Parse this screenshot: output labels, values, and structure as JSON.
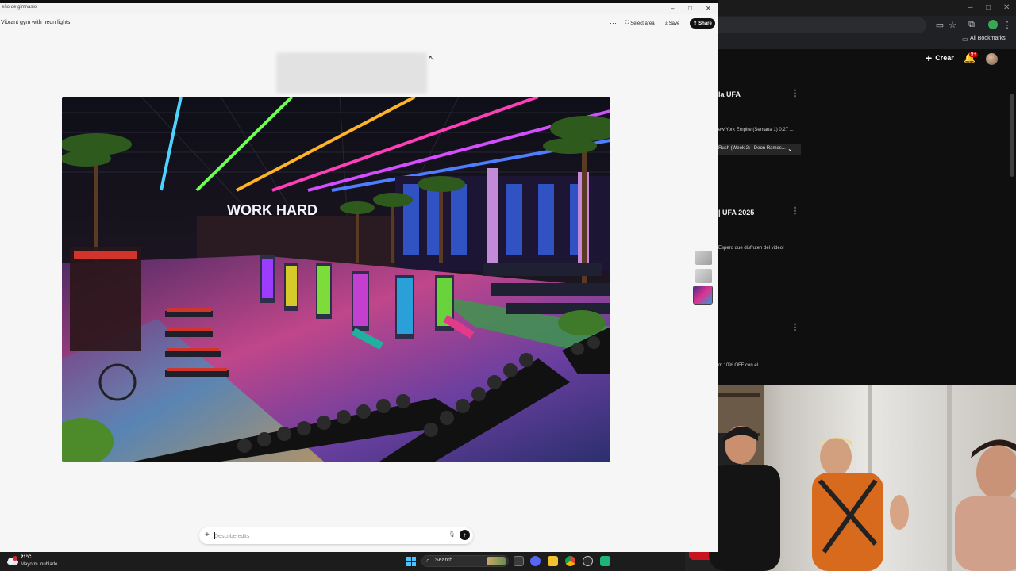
{
  "designer": {
    "window_title": "eño de gimnasio",
    "prompt_title": "Vibrant gym with neon lights",
    "header": {
      "more_icon": "more-horizontal-icon",
      "select_area_label": "Select area",
      "save_label": "Save",
      "share_label": "Share"
    },
    "image": {
      "sign_text": "WORK HARD"
    },
    "prompt_bar": {
      "placeholder": "Describe edits"
    }
  },
  "browser": {
    "all_bookmarks_label": "All Bookmarks"
  },
  "youtube": {
    "create_label": "Crear",
    "notification_badge": "9+",
    "items": [
      {
        "title": "la UFA",
        "subtitle": "ew York Empire (Semana 1) 0:27 ...",
        "chip": "Rush (Week 2) | Deon Ramos..."
      },
      {
        "title": "| UFA 2025",
        "subtitle": "Espero que disfruten del video!"
      },
      {
        "title": "",
        "subtitle": "m 10% OFF con el ..."
      }
    ]
  },
  "taskbar": {
    "weather_temp": "21°C",
    "weather_desc": "Mayorm. nublado",
    "search_label": "Search"
  },
  "colors": {
    "share_button": "#111111",
    "youtube_bg": "#0f0f0f",
    "start_icon": "#4cc2ff"
  }
}
